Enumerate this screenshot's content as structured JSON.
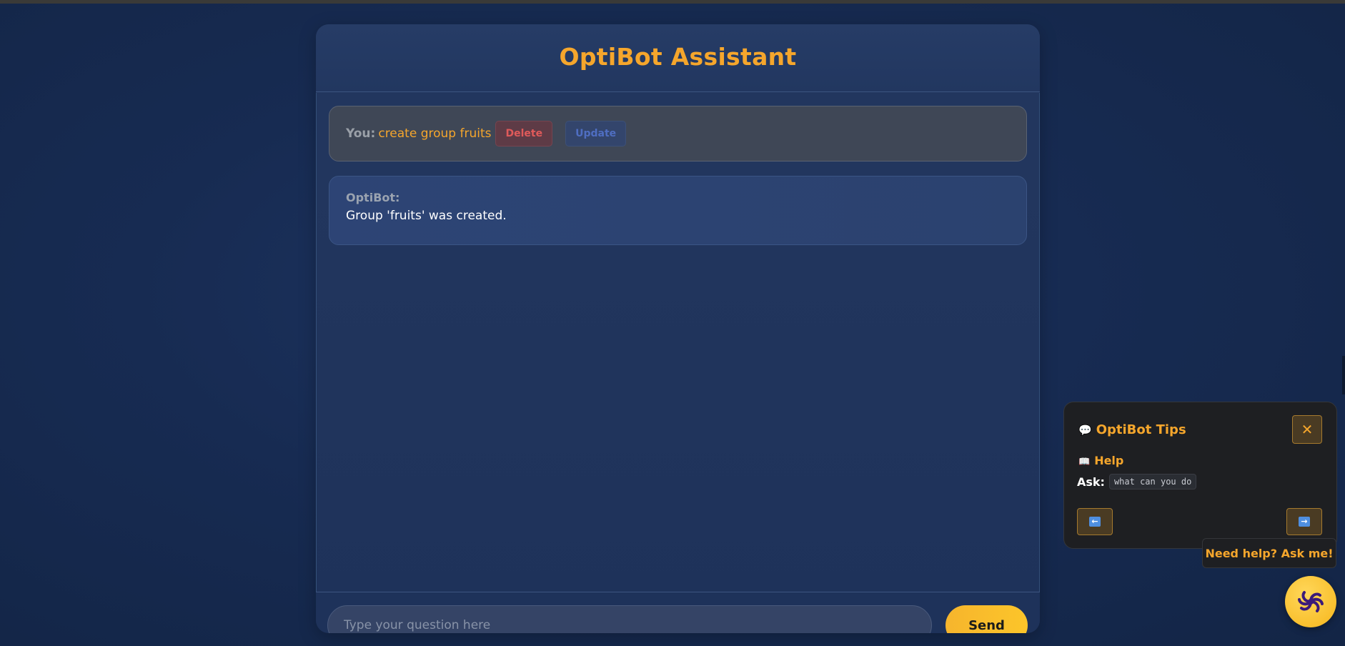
{
  "header": {
    "title": "OptiBot Assistant"
  },
  "chat": {
    "messages": [
      {
        "sender_label": "You:",
        "text": "create group fruits",
        "delete_label": "Delete",
        "update_label": "Update"
      },
      {
        "sender_label": "OptiBot:",
        "text": "Group 'fruits' was created."
      }
    ]
  },
  "composer": {
    "placeholder": "Type your question here",
    "value": "",
    "send_label": "Send"
  },
  "tips": {
    "title_icon": "speech-bubble-icon",
    "title": "OptiBot Tips",
    "close_label": "✕",
    "section_icon": "book-icon",
    "section_title": "Help",
    "ask_label": "Ask:",
    "ask_example": "what can you do",
    "prev_icon": "left-arrow-icon",
    "next_icon": "right-arrow-icon"
  },
  "help_bubble": {
    "text": "Need help? Ask me!"
  },
  "launcher": {
    "icon": "swirl-logo-icon"
  },
  "colors": {
    "accent": "#f5a62c",
    "background": "#172b52",
    "panel": "#23375f",
    "delete": "#e05a5a",
    "update": "#4f6ec2",
    "logo_purple": "#3b1a7a"
  }
}
